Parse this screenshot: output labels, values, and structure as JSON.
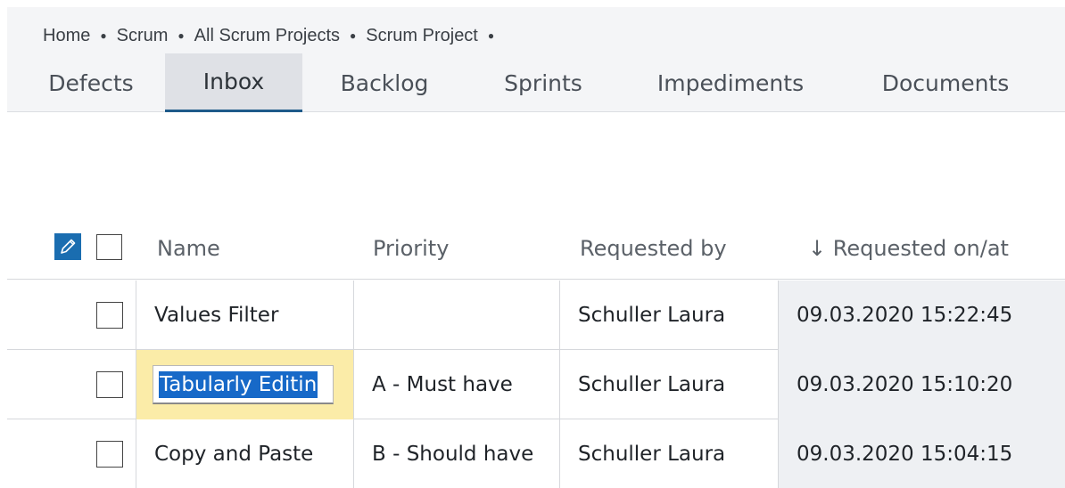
{
  "breadcrumb": [
    "Home",
    "Scrum",
    "All Scrum Projects",
    "Scrum Project"
  ],
  "tabs": [
    {
      "label": "Defects",
      "active": false
    },
    {
      "label": "Inbox",
      "active": true
    },
    {
      "label": "Backlog",
      "active": false
    },
    {
      "label": "Sprints",
      "active": false
    },
    {
      "label": "Impediments",
      "active": false
    },
    {
      "label": "Documents",
      "active": false
    }
  ],
  "table": {
    "columns": {
      "name": "Name",
      "priority": "Priority",
      "requested_by": "Requested by",
      "requested_on": "↓ Requested on/at"
    },
    "rows": [
      {
        "name": "Values Filter",
        "priority": "",
        "requested_by": "Schuller Laura",
        "requested_on": "09.03.2020 15:22:45"
      },
      {
        "name": "Tabularly Editin",
        "priority": "A - Must have",
        "requested_by": "Schuller Laura",
        "requested_on": "09.03.2020 15:10:20"
      },
      {
        "name": "Copy and Paste",
        "priority": "B - Should have",
        "requested_by": "Schuller Laura",
        "requested_on": "09.03.2020 15:04:15"
      }
    ]
  },
  "icons": {
    "edit": "pencil-icon"
  },
  "colors": {
    "accent": "#1e5a8a",
    "edit_icon_bg": "#1a6db0",
    "editing_cell": "#fbeca8",
    "selection": "#1769c8"
  }
}
